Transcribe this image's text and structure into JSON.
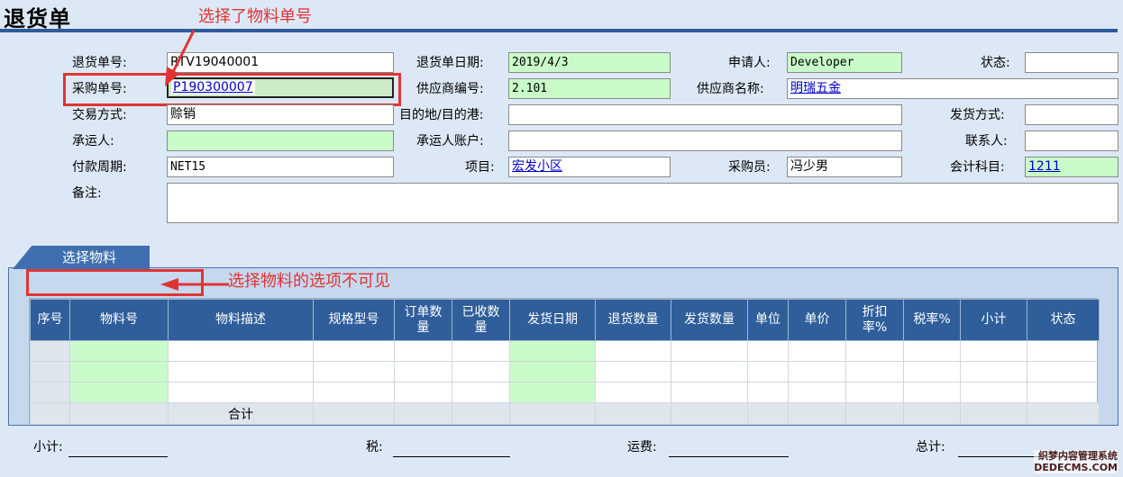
{
  "header": {
    "title": "退货单"
  },
  "annotations": {
    "top": "选择了物料单号",
    "middle": "选择物料的选项不可见"
  },
  "form": {
    "return_no_label": "退货单号:",
    "return_no_value": "RTV19040001",
    "return_date_label": "退货单日期:",
    "return_date_value": "2019/4/3",
    "applicant_label": "申请人:",
    "applicant_value": "Developer",
    "status_label": "状态:",
    "status_value": "",
    "po_no_label": "采购单号:",
    "po_no_value": "P190300007",
    "supplier_no_label": "供应商编号:",
    "supplier_no_value": "2.101",
    "supplier_name_label": "供应商名称:",
    "supplier_name_value": "明瑞五金",
    "trade_mode_label": "交易方式:",
    "trade_mode_value": "赊销",
    "destination_label": "目的地/目的港:",
    "destination_value": "",
    "ship_method_label": "发货方式:",
    "ship_method_value": "",
    "carrier_label": "承运人:",
    "carrier_value": "",
    "carrier_account_label": "承运人账户:",
    "carrier_account_value": "",
    "contact_label": "联系人:",
    "contact_value": "",
    "payment_term_label": "付款周期:",
    "payment_term_value": "NET15",
    "project_label": "项目:",
    "project_value": "宏发小区",
    "buyer_label": "采购员:",
    "buyer_value": "冯少男",
    "account_label": "会计科目:",
    "account_value": "1211",
    "remark_label": "备注:",
    "remark_value": ""
  },
  "tab": {
    "label": "选择物料"
  },
  "grid": {
    "columns": [
      "序号",
      "物料号",
      "物料描述",
      "规格型号",
      "订单数量",
      "已收数量",
      "发货日期",
      "退货数量",
      "发货数量",
      "单位",
      "单价",
      "折扣率%",
      "税率%",
      "小计",
      "状态"
    ],
    "column_lines": [
      [
        "序号"
      ],
      [
        "物料号"
      ],
      [
        "物料描述"
      ],
      [
        "规格型号"
      ],
      [
        "订单数",
        "量"
      ],
      [
        "已收数",
        "量"
      ],
      [
        "发货日期"
      ],
      [
        "退货数量"
      ],
      [
        "发货数量"
      ],
      [
        "单位"
      ],
      [
        "单价"
      ],
      [
        "折扣",
        "率%"
      ],
      [
        "税率%"
      ],
      [
        "小计"
      ],
      [
        "状态"
      ]
    ],
    "rows": 3,
    "summary_label": "合计"
  },
  "footer": {
    "subtotal_label": "小计:",
    "tax_label": "税:",
    "freight_label": "运费:",
    "total_label": "总计:"
  },
  "watermark": {
    "line1": "织梦内容管理系统",
    "line2": "DEDECMS.COM"
  },
  "colors": {
    "header_blue": "#2f5e9a",
    "required_green": "#c9fbc9",
    "annotation_red": "#e03434",
    "background": "#dde8f6"
  }
}
